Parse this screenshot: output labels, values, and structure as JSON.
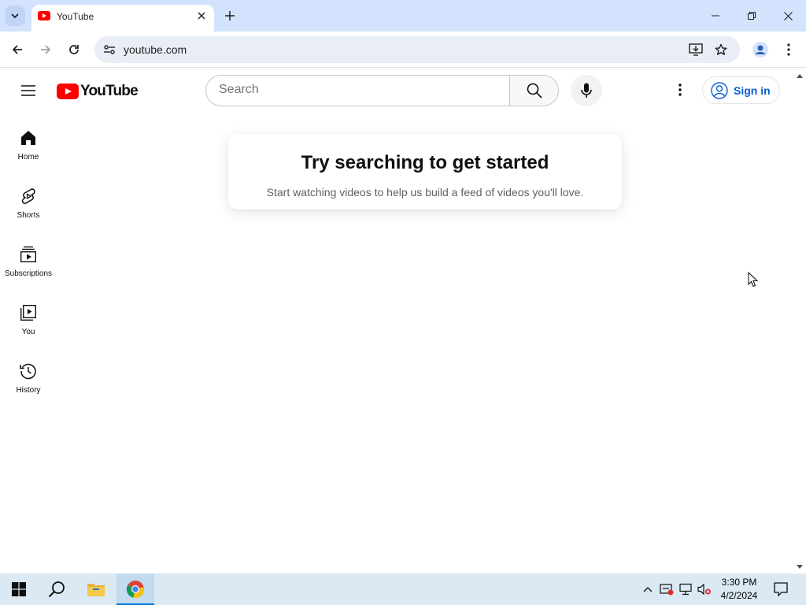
{
  "browser": {
    "tab": {
      "title": "YouTube",
      "favicon": "youtube-favicon"
    },
    "new_tab_icon": "plus-icon",
    "window_controls": [
      "minimize-icon",
      "restore-icon",
      "close-icon"
    ],
    "url": "youtube.com",
    "toolbar_icons": [
      "back-arrow-icon",
      "forward-arrow-icon",
      "reload-icon",
      "site-info-icon",
      "install-app-icon",
      "bookmark-star-icon",
      "profile-icon",
      "kebab-menu-icon"
    ]
  },
  "youtube": {
    "logo_text": "YouTube",
    "logo_color": "#ff0000",
    "search": {
      "placeholder": "Search",
      "value": ""
    },
    "sign_in_label": "Sign in",
    "accent_color": "#065fd4",
    "guide": [
      {
        "label": "Home",
        "icon": "home-icon"
      },
      {
        "label": "Shorts",
        "icon": "shorts-icon"
      },
      {
        "label": "Subscriptions",
        "icon": "subscriptions-icon"
      },
      {
        "label": "You",
        "icon": "you-library-icon"
      },
      {
        "label": "History",
        "icon": "history-icon"
      }
    ],
    "empty_feed": {
      "title": "Try searching to get started",
      "subtitle": "Start watching videos to help us build a feed of videos you'll love."
    }
  },
  "taskbar": {
    "apps": [
      "windows-start-icon",
      "search-icon",
      "file-explorer-icon",
      "chrome-icon"
    ],
    "tray_icons": [
      "chevron-up-icon",
      "security-icon",
      "network-icon",
      "volume-muted-icon",
      "notifications-icon"
    ],
    "time": "3:30 PM",
    "date": "4/2/2024"
  }
}
